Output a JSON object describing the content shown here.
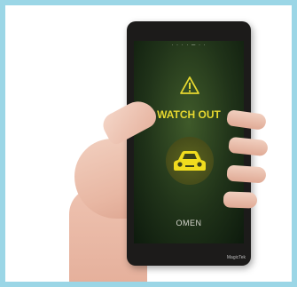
{
  "screen": {
    "alert_title": "WATCH OUT",
    "bottom_label": "OMEN",
    "brand": "MagicTek"
  },
  "icons": {
    "warning": "warning-triangle-icon",
    "car": "car-icon"
  },
  "colors": {
    "frame": "#9bd6e6",
    "alert": "#e6d830",
    "screen": "#203319"
  }
}
